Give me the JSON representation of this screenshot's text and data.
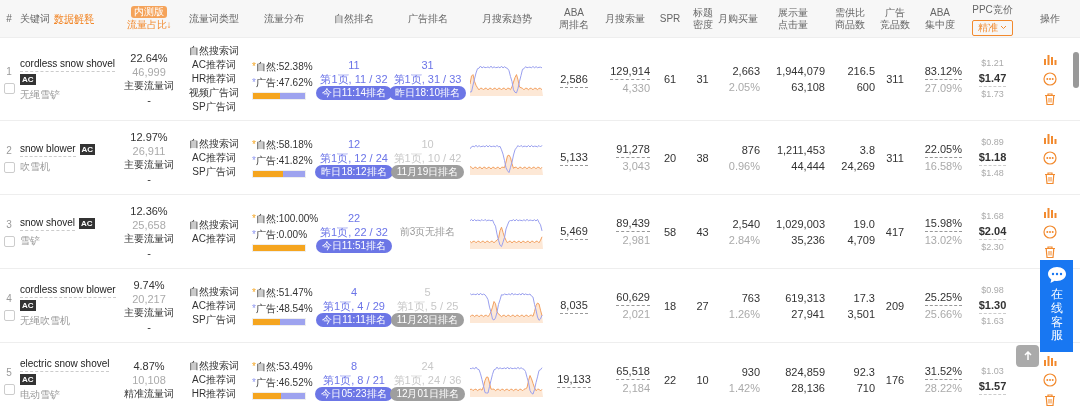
{
  "header": [
    {
      "kind": "plain",
      "label": "#"
    },
    {
      "kind": "keyword",
      "label": "关键词",
      "link": "数据解释"
    },
    {
      "kind": "sorted",
      "label": "流量占比↓",
      "badge": "内测版"
    },
    {
      "kind": "plain",
      "label": "流量词类型"
    },
    {
      "kind": "plain",
      "label": "流量分布"
    },
    {
      "kind": "plain",
      "label": "自然排名"
    },
    {
      "kind": "plain",
      "label": "广告排名"
    },
    {
      "kind": "plain",
      "label": "月搜索趋势"
    },
    {
      "kind": "plain",
      "lines": [
        "ABA",
        "周排名"
      ]
    },
    {
      "kind": "plain",
      "label": "月搜索量"
    },
    {
      "kind": "plain",
      "label": "SPR"
    },
    {
      "kind": "plain",
      "lines": [
        "标题",
        "密度"
      ]
    },
    {
      "kind": "plain",
      "label": "月购买量"
    },
    {
      "kind": "plain",
      "lines": [
        "展示量",
        "点击量"
      ]
    },
    {
      "kind": "plain",
      "lines": [
        "需供比",
        "商品数"
      ]
    },
    {
      "kind": "plain",
      "lines": [
        "广告",
        "竞品数"
      ]
    },
    {
      "kind": "plain",
      "lines": [
        "ABA",
        "集中度"
      ]
    },
    {
      "kind": "ppc",
      "label": "PPC竞价",
      "dropdown": "精准"
    },
    {
      "kind": "plain",
      "label": "操作"
    }
  ],
  "rows": [
    {
      "index": "1",
      "keyword": "cordless snow shovel",
      "badge": "AC",
      "translation": "无绳雪铲",
      "share": "22.64%",
      "count": "46,999",
      "tag": "主要流量词",
      "note": "-",
      "types": [
        "自然搜索词",
        "AC推荐词",
        "HR推荐词",
        "视频广告词",
        "SP广告词"
      ],
      "dist": [
        {
          "mark": "*",
          "label": "自然:",
          "value": "52.38%"
        },
        {
          "mark": "*",
          "label": "广告:",
          "value": "47.62%"
        }
      ],
      "level": 0.5238,
      "organic": {
        "kind": "ranked",
        "rank": "11",
        "page": "第1页, 11 / 32",
        "time": "今日11:14排名",
        "recent": true
      },
      "ad": {
        "kind": "ranked",
        "rank": "31",
        "page": "第1页, 31 / 33",
        "time": "昨日18:10排名",
        "recent": true
      },
      "aba": "2,586",
      "search": "129,914",
      "search_sub": "4,330",
      "spr": "61",
      "density": "31",
      "purchases": "2,663",
      "purchase_rate": "2.05%",
      "impressions": "1,944,079",
      "clicks": "63,108",
      "ratio": "216.5",
      "products": "600",
      "ad_competitors": "311",
      "concentration": "83.12%",
      "concentration_sub": "27.09%",
      "ppc": [
        "$1.21",
        "$1.47",
        "$1.73"
      ],
      "checked": false
    },
    {
      "index": "2",
      "keyword": "snow blower",
      "badge": "AC",
      "translation": "吹雪机",
      "share": "12.97%",
      "count": "26,911",
      "tag": "主要流量词",
      "note": "-",
      "types": [
        "自然搜索词",
        "AC推荐词",
        "SP广告词"
      ],
      "dist": [
        {
          "mark": "*",
          "label": "自然:",
          "value": "58.18%"
        },
        {
          "mark": "*",
          "label": "广告:",
          "value": "41.82%"
        }
      ],
      "level": 0.5818,
      "organic": {
        "kind": "ranked",
        "rank": "12",
        "page": "第1页, 12 / 24",
        "time": "昨日18:12排名",
        "recent": true
      },
      "ad": {
        "kind": "ranked",
        "rank": "10",
        "page": "第1页, 10 / 42",
        "time": "11月19日排名",
        "recent": false
      },
      "aba": "5,133",
      "search": "91,278",
      "search_sub": "3,043",
      "spr": "20",
      "density": "38",
      "purchases": "876",
      "purchase_rate": "0.96%",
      "impressions": "1,211,453",
      "clicks": "44,444",
      "ratio": "3.8",
      "products": "24,269",
      "ad_competitors": "311",
      "concentration": "22.05%",
      "concentration_sub": "16.58%",
      "ppc": [
        "$0.89",
        "$1.18",
        "$1.48"
      ],
      "checked": false
    },
    {
      "index": "3",
      "keyword": "snow shovel",
      "badge": "AC",
      "translation": "雪铲",
      "share": "12.36%",
      "count": "25,658",
      "tag": "主要流量词",
      "note": "-",
      "types": [
        "自然搜索词",
        "AC推荐词"
      ],
      "dist": [
        {
          "mark": "*",
          "label": "自然:",
          "value": "100.00%"
        },
        {
          "mark": "*",
          "label": "广告:",
          "value": "0.00%"
        }
      ],
      "level": 1,
      "organic": {
        "kind": "ranked",
        "rank": "22",
        "page": "第1页, 22 / 32",
        "time": "今日11:51排名",
        "recent": true
      },
      "ad": {
        "kind": "none",
        "text": "前3页无排名"
      },
      "aba": "5,469",
      "search": "89,439",
      "search_sub": "2,981",
      "spr": "58",
      "density": "43",
      "purchases": "2,540",
      "purchase_rate": "2.84%",
      "impressions": "1,029,003",
      "clicks": "35,236",
      "ratio": "19.0",
      "products": "4,709",
      "ad_competitors": "417",
      "concentration": "15.98%",
      "concentration_sub": "13.02%",
      "ppc": [
        "$1.68",
        "$2.04",
        "$2.30"
      ],
      "checked": false
    },
    {
      "index": "4",
      "keyword": "cordless snow blower",
      "badge": "AC",
      "translation": "无绳吹雪机",
      "share": "9.74%",
      "count": "20,217",
      "tag": "主要流量词",
      "note": "-",
      "types": [
        "自然搜索词",
        "AC推荐词",
        "SP广告词"
      ],
      "dist": [
        {
          "mark": "*",
          "label": "自然:",
          "value": "51.47%"
        },
        {
          "mark": "*",
          "label": "广告:",
          "value": "48.54%"
        }
      ],
      "level": 0.5147,
      "organic": {
        "kind": "ranked",
        "rank": "4",
        "page": "第1页, 4 / 29",
        "time": "今日11:11排名",
        "recent": true
      },
      "ad": {
        "kind": "ranked",
        "rank": "5",
        "page": "第1页, 5 / 25",
        "time": "11月23日排名",
        "recent": false
      },
      "aba": "8,035",
      "search": "60,629",
      "search_sub": "2,021",
      "spr": "18",
      "density": "27",
      "purchases": "763",
      "purchase_rate": "1.26%",
      "impressions": "619,313",
      "clicks": "27,941",
      "ratio": "17.3",
      "products": "3,501",
      "ad_competitors": "209",
      "concentration": "25.25%",
      "concentration_sub": "25.66%",
      "ppc": [
        "$0.98",
        "$1.30",
        "$1.63"
      ],
      "checked": false
    },
    {
      "index": "5",
      "keyword": "electric snow shovel",
      "badge": "AC",
      "translation": "电动雪铲",
      "share": "4.87%",
      "count": "10,108",
      "tag": "精准流量词",
      "types": [
        "自然搜索词",
        "AC推荐词",
        "HR推荐词"
      ],
      "dist": [
        {
          "mark": "*",
          "label": "自然:",
          "value": "53.49%"
        },
        {
          "mark": "*",
          "label": "广告:",
          "value": "46.52%"
        }
      ],
      "level": 0.5349,
      "organic": {
        "kind": "ranked",
        "rank": "8",
        "page": "第1页, 8 / 21",
        "time": "今日05:23排名",
        "recent": true
      },
      "ad": {
        "kind": "ranked",
        "rank": "24",
        "page": "第1页, 24 / 36",
        "time": "12月01日排名",
        "recent": false
      },
      "aba": "19,133",
      "search": "65,518",
      "search_sub": "2,184",
      "spr": "22",
      "density": "10",
      "purchases": "930",
      "purchase_rate": "1.42%",
      "impressions": "824,859",
      "clicks": "28,136",
      "ratio": "92.3",
      "products": "710",
      "ad_competitors": "176",
      "concentration": "31.52%",
      "concentration_sub": "28.22%",
      "ppc": [
        "$1.03",
        "$1.57"
      ],
      "checked": false
    }
  ],
  "support": {
    "label": "在线客服"
  }
}
